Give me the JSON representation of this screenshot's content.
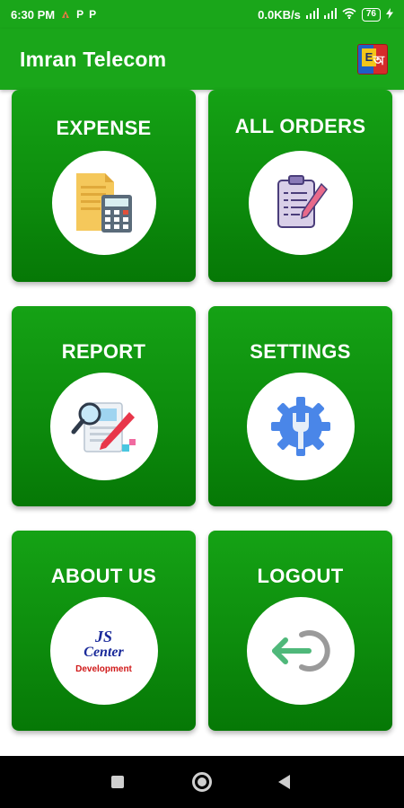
{
  "status_bar": {
    "time": "6:30 PM",
    "left_icons": [
      "app-notification-icon",
      "p-icon",
      "p-icon"
    ],
    "net_speed": "0.0KB/s",
    "battery": "76"
  },
  "app_bar": {
    "title": "Imran Telecom",
    "lang_letter_en": "E",
    "lang_letter_bn": "অ"
  },
  "tiles": [
    {
      "label": "EXPENSE",
      "icon": "calculator-document-icon"
    },
    {
      "label": "ALL ORDERS",
      "icon": "clipboard-icon"
    },
    {
      "label": "REPORT",
      "icon": "report-magnifier-icon"
    },
    {
      "label": "SETTINGS",
      "icon": "gear-wrench-icon"
    },
    {
      "label": "ABOUT US",
      "icon": "js-center-logo",
      "logo_line1": "JS",
      "logo_line2": "Center",
      "logo_line3": "Development"
    },
    {
      "label": "LOGOUT",
      "icon": "logout-icon"
    }
  ],
  "colors": {
    "primary": "#1aa61a",
    "tile_dark": "#067806",
    "nav_bar": "#000000"
  }
}
